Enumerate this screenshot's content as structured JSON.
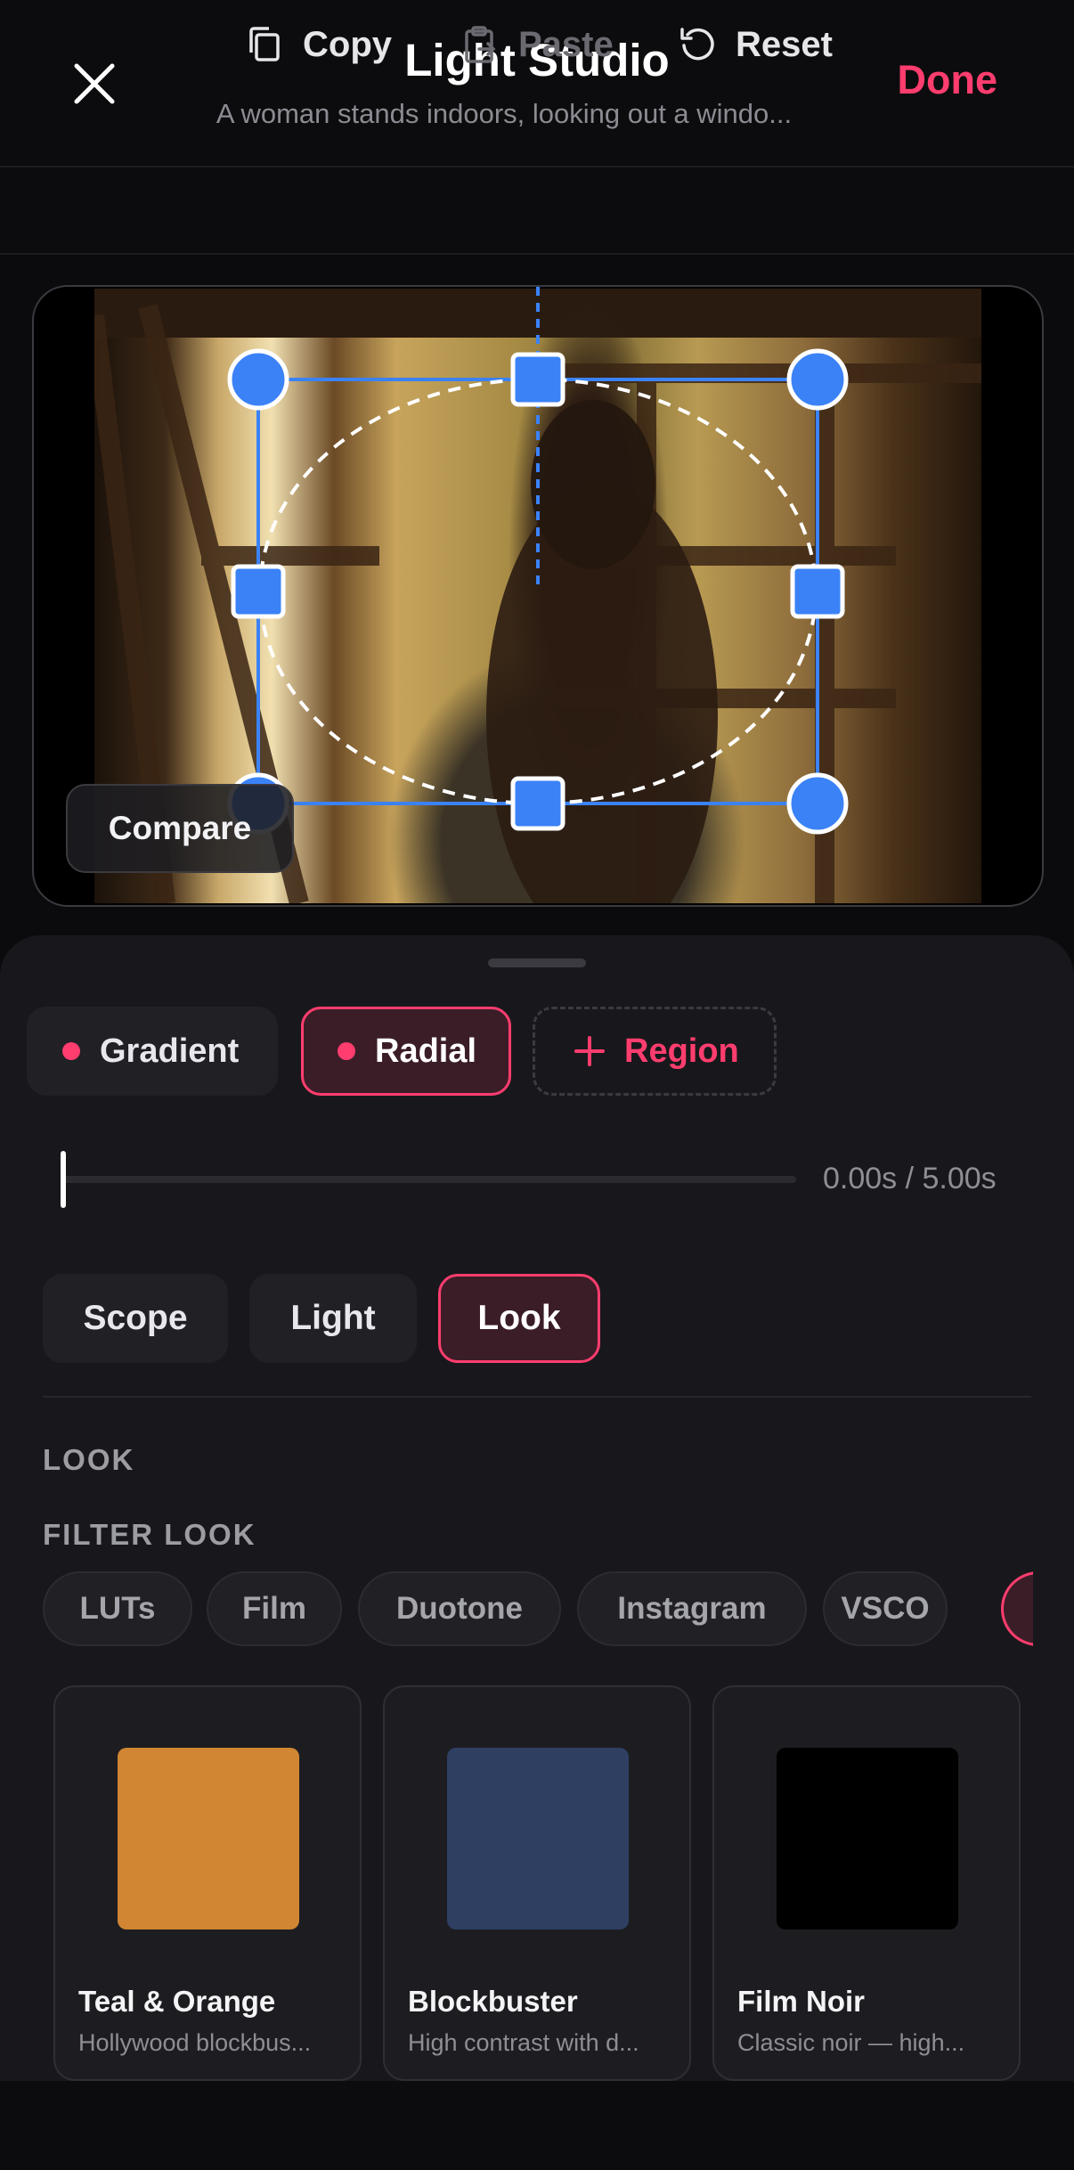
{
  "header": {
    "title": "Light Studio",
    "subtitle": "A woman stands indoors, looking out a windo...",
    "done_label": "Done"
  },
  "toolbar": {
    "copy_label": "Copy",
    "paste_label": "Paste",
    "reset_label": "Reset"
  },
  "canvas": {
    "compare_label": "Compare"
  },
  "masks": {
    "gradient_label": "Gradient",
    "radial_label": "Radial",
    "region_label": "Region",
    "selected": "Radial"
  },
  "timeline": {
    "time_text": "0.00s / 5.00s",
    "progress": 0.0
  },
  "tabs": {
    "scope_label": "Scope",
    "light_label": "Light",
    "look_label": "Look",
    "selected": "Look"
  },
  "look": {
    "section_label": "LOOK",
    "filter_label": "FILTER LOOK",
    "filters": [
      "LUTs",
      "Film",
      "Duotone",
      "Instagram",
      "VSCO"
    ],
    "cards": [
      {
        "name": "Teal & Orange",
        "desc": "Hollywood blockbus...",
        "color": "#d08633"
      },
      {
        "name": "Blockbuster",
        "desc": "High contrast with d...",
        "color": "#2e3f62"
      },
      {
        "name": "Film Noir",
        "desc": "Classic noir — high...",
        "color": "#000000"
      }
    ]
  },
  "colors": {
    "accent": "#ff3d6e",
    "handle": "#3b82f6",
    "background": "#0b0b0d",
    "sheet": "#18181c"
  },
  "icons": [
    "close-icon",
    "copy-icon",
    "paste-icon",
    "reset-icon",
    "plus-icon"
  ]
}
